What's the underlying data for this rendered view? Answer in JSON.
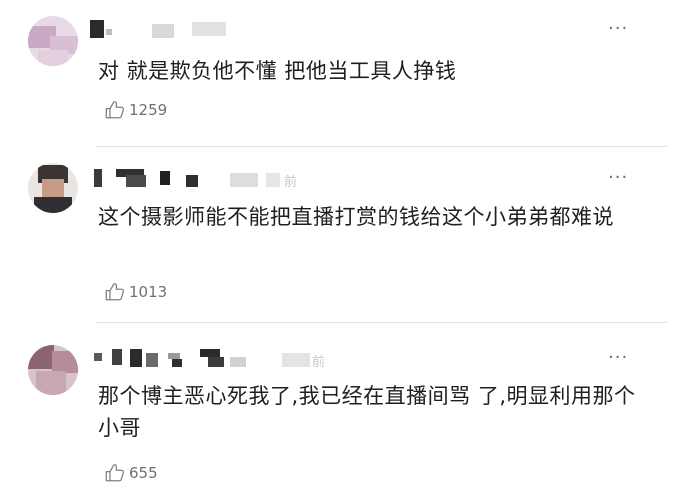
{
  "comments": [
    {
      "text": "对 就是欺负他不懂 把他当工具人挣钱",
      "likes": "1259"
    },
    {
      "text": "这个摄影师能不能把直播打赏的钱给这个小弟弟都难说",
      "likes": "1013"
    },
    {
      "text": "那个博主恶心死我了,我已经在直播间骂 了,明显利用那个小哥",
      "likes": "655"
    }
  ],
  "more_label": "···",
  "icons": {
    "like": "thumbs-up-icon",
    "more": "more-icon"
  },
  "colors": {
    "text": "#1f1f1f",
    "muted": "#808080",
    "divider": "#e4e4e4"
  }
}
